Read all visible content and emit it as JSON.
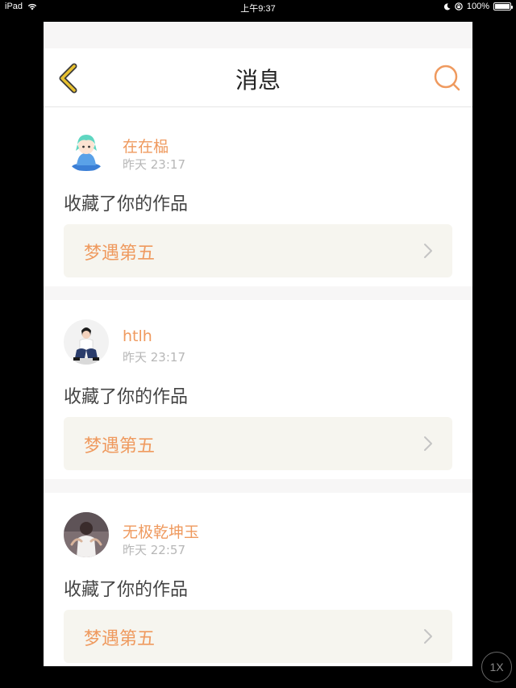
{
  "status_bar": {
    "device": "iPad",
    "time": "上午9:37",
    "battery": "100%"
  },
  "nav": {
    "title": "消息",
    "back_icon": "chevron-left-icon",
    "search_icon": "search-icon"
  },
  "messages": [
    {
      "username": "在在榀",
      "time": "昨天 23:17",
      "action": "收藏了你的作品",
      "work_title": "梦遇第五"
    },
    {
      "username": "htlh",
      "time": "昨天 23:17",
      "action": "收藏了你的作品",
      "work_title": "梦遇第五"
    },
    {
      "username": "无极乾坤玉",
      "time": "昨天 22:57",
      "action": "收藏了你的作品",
      "work_title": "梦遇第五"
    }
  ],
  "zoom_button": {
    "label": "1X"
  },
  "colors": {
    "accent": "#ef9a5f",
    "back_icon": "#e8c12f",
    "work_box_bg": "#f6f5ef"
  }
}
